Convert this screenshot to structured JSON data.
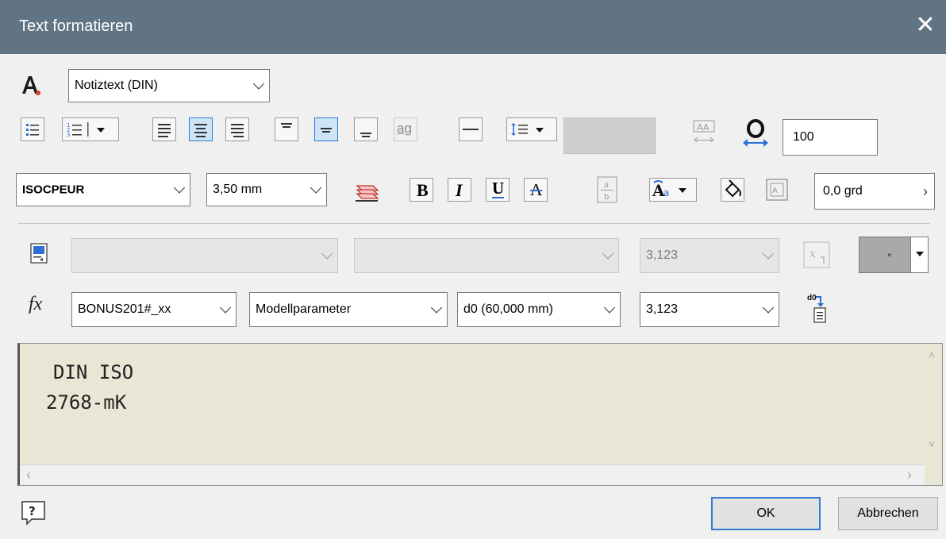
{
  "window": {
    "title": "Text formatieren"
  },
  "toolbar": {
    "style_select": "Notiztext (DIN)",
    "font_select": "ISOCPEUR",
    "size_select": "3,50 mm",
    "width_scale": "100",
    "rotation": "0,0 grd",
    "bold_label": "B",
    "italic_label": "I",
    "underline_label": "U",
    "strike_label": "A",
    "case_label": "ag"
  },
  "parameters": {
    "precision_value": "3,123",
    "component_select": "BONUS201#_xx",
    "param_type_select": "Modellparameter",
    "param_select": "d0 (60,000 mm)",
    "precision_select": "3,123",
    "fx_label": "fx",
    "d0_label": "d0"
  },
  "editor": {
    "lines": [
      "DIN ISO",
      "2768-mK"
    ]
  },
  "footer": {
    "ok_label": "OK",
    "cancel_label": "Abbrechen"
  },
  "colors": {
    "titlebar": "#617484",
    "editor_bg": "#e8e6d5",
    "accent": "#2e7cd4"
  }
}
